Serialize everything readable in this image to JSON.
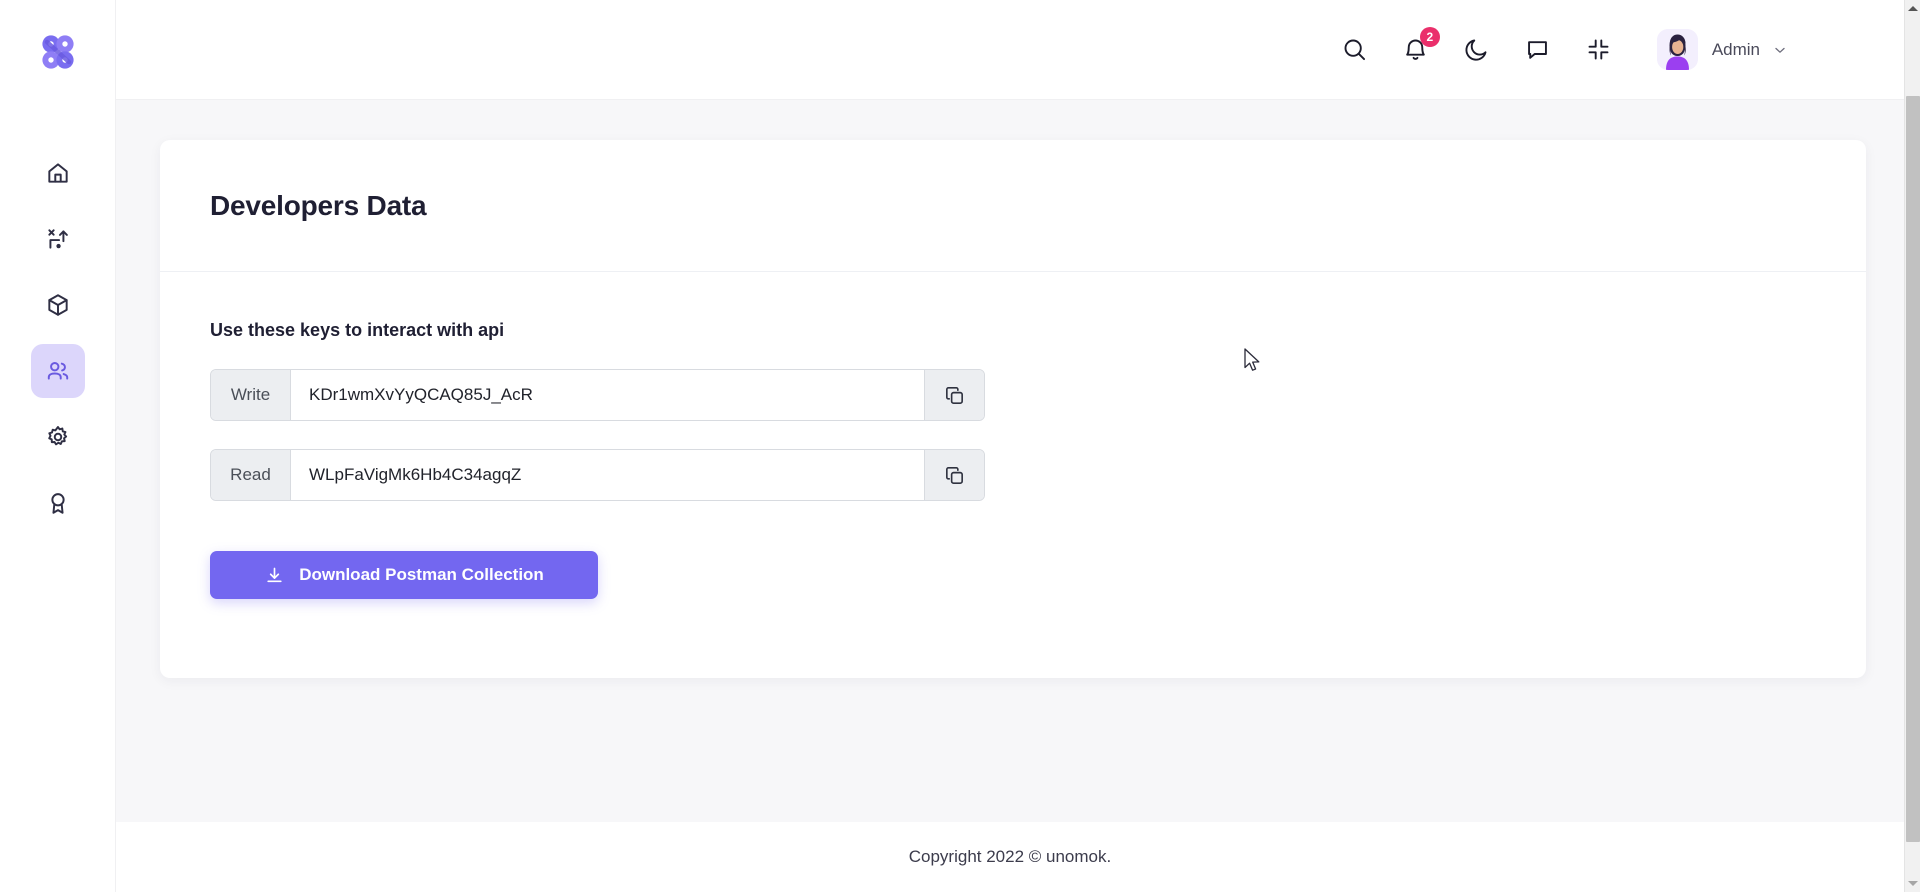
{
  "app": {
    "logo_name": "unomok-logo"
  },
  "sidebar": {
    "items": [
      {
        "label": "Home",
        "icon": "home-icon",
        "active": false
      },
      {
        "label": "Shipments",
        "icon": "route-icon",
        "active": false
      },
      {
        "label": "Packages",
        "icon": "box-icon",
        "active": false
      },
      {
        "label": "Developers",
        "icon": "users-icon",
        "active": true
      },
      {
        "label": "Settings",
        "icon": "gear-icon",
        "active": false
      },
      {
        "label": "Rewards",
        "icon": "award-icon",
        "active": false
      }
    ]
  },
  "header": {
    "actions": [
      {
        "name": "search-icon",
        "label": "Search"
      },
      {
        "name": "bell-icon",
        "label": "Notifications",
        "badge": "2"
      },
      {
        "name": "moon-icon",
        "label": "Dark mode"
      },
      {
        "name": "chat-icon",
        "label": "Messages"
      },
      {
        "name": "collapse-icon",
        "label": "Exit full screen"
      }
    ],
    "notification_count": "2",
    "user": {
      "name": "Admin",
      "avatar": "user-avatar",
      "caret": "chevron-down-icon"
    }
  },
  "main": {
    "page_title": "Developers Data",
    "subtitle": "Use these keys to interact with api",
    "keys": [
      {
        "label": "Write",
        "value": "KDr1wmXvYyQCAQ85J_AcR",
        "copy_icon": "copy-icon"
      },
      {
        "label": "Read",
        "value": "WLpFaVigMk6Hb4C34agqZ",
        "copy_icon": "copy-icon"
      }
    ],
    "download_button": {
      "label": "Download Postman Collection",
      "icon": "download-icon",
      "color": "#7367f0"
    }
  },
  "footer": {
    "text": "Copyright 2022 © unomok."
  },
  "colors": {
    "accent": "#7367f0",
    "accent_soft": "#dcd6fb",
    "badge": "#ea2f6b",
    "page_bg": "#f7f7f9",
    "text_dark": "#1f1f33"
  }
}
